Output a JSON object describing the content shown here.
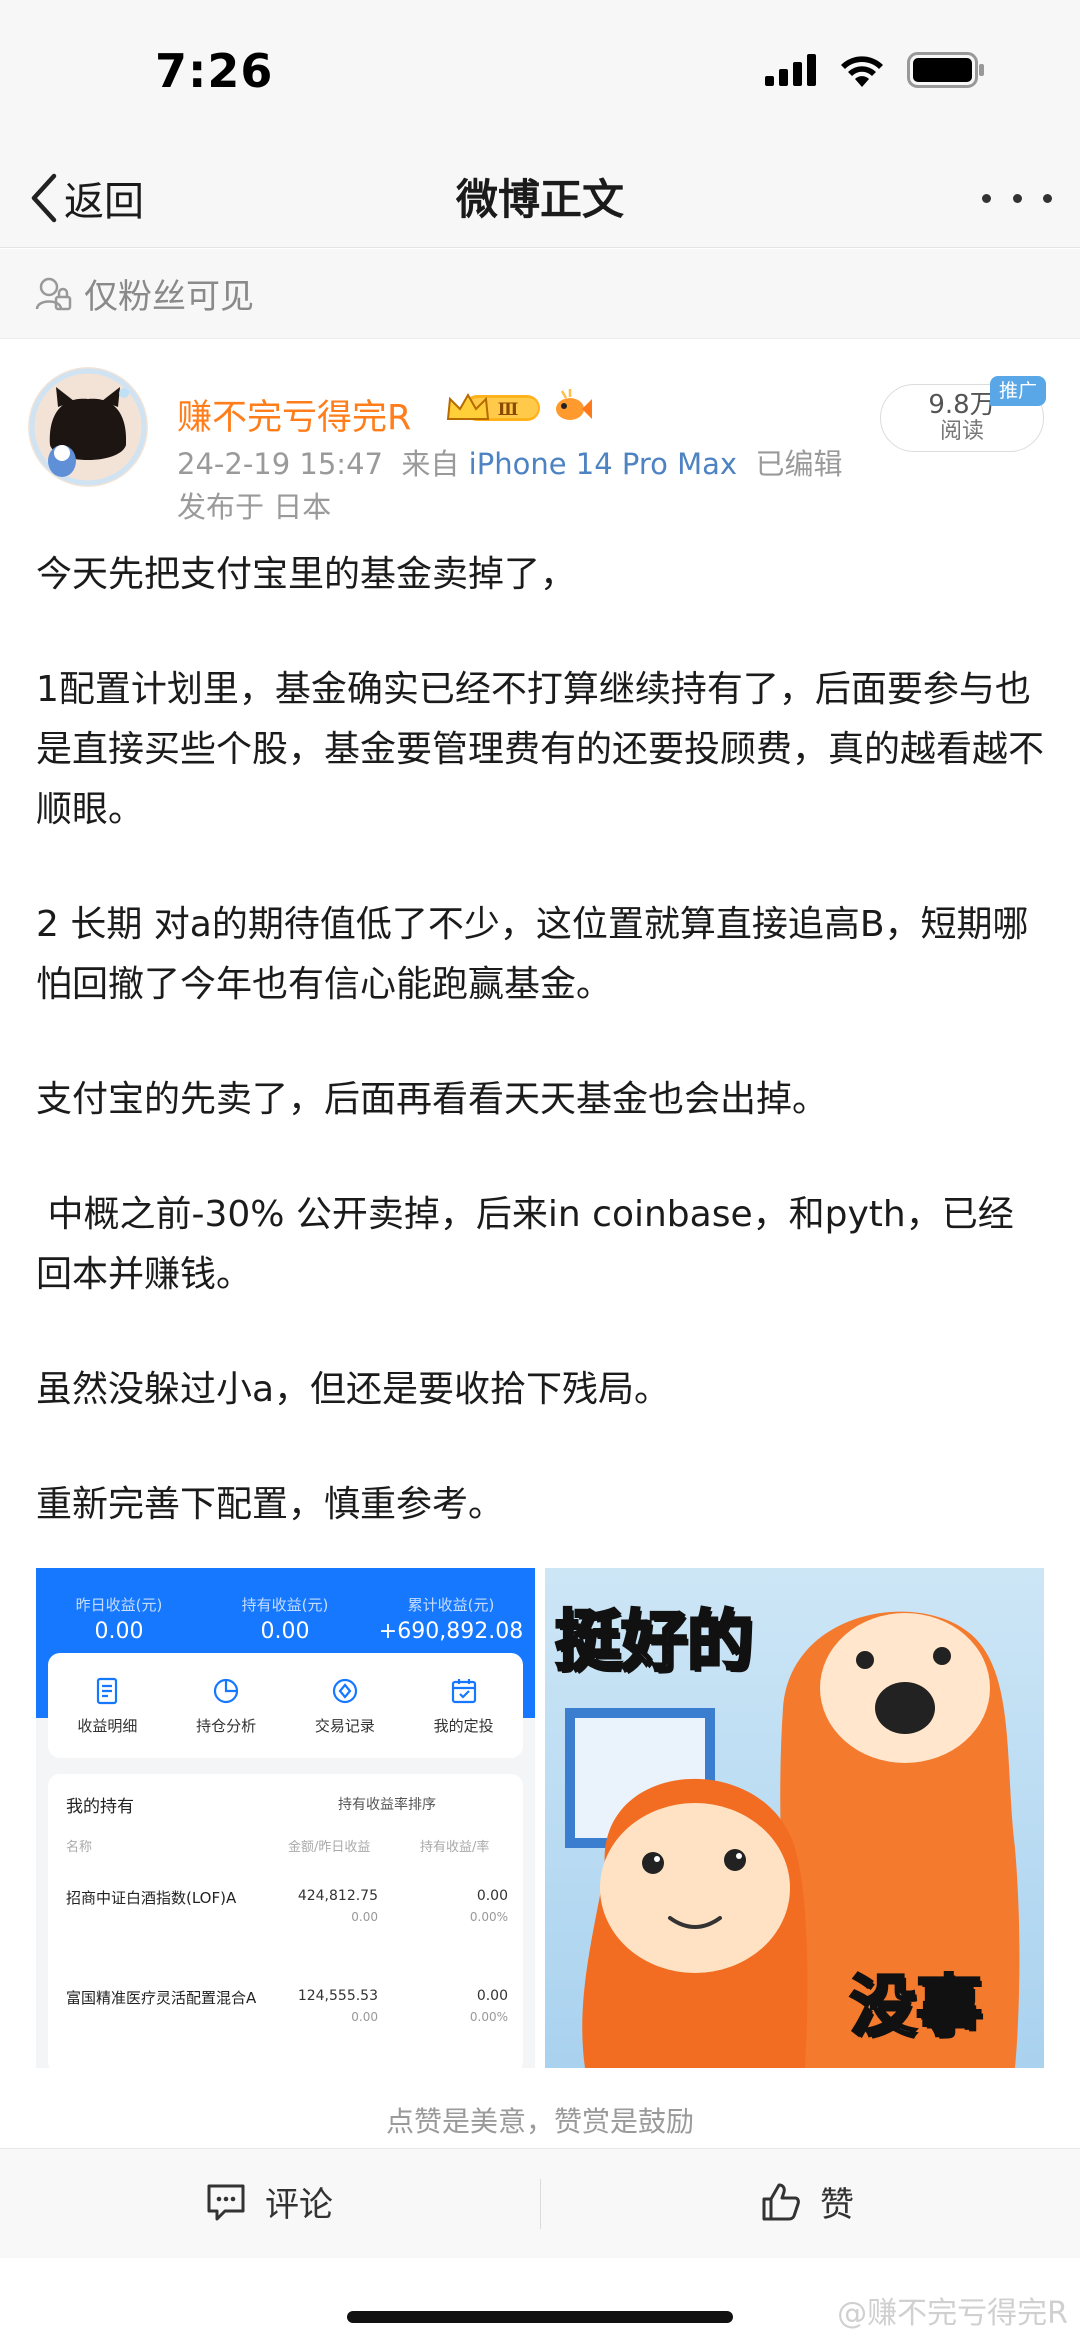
{
  "status_bar": {
    "time": "7:26"
  },
  "nav": {
    "back_label": "返回",
    "title": "微博正文"
  },
  "visibility": {
    "label": "仅粉丝可见"
  },
  "post": {
    "username": "赚不完亏得完R",
    "level_badge": "Ⅲ",
    "meta_time": "24-2-19 15:47",
    "meta_from": "来自",
    "meta_device": "iPhone 14 Pro Max",
    "meta_edited": "已编辑",
    "meta_location": "发布于 日本",
    "reads_count": "9.8万",
    "reads_label": "阅读",
    "promo_tag": "推广",
    "paragraphs": [
      "今天先把支付宝里的基金卖掉了，",
      "1配置计划里，基金确实已经不打算继续持有了，后面要参与也是直接买些个股，基金要管理费有的还要投顾费，真的越看越不顺眼。",
      "2 长期 对a的期待值低了不少，这位置就算直接追高B，短期哪怕回撤了今年也有信心能跑赢基金。",
      "支付宝的先卖了，后面再看看天天基金也会出掉。",
      " 中概之前-30% 公开卖掉，后来in coinbase，和pyth，已经回本并赚钱。",
      "虽然没躲过小a，但还是要收拾下残局。",
      "重新完善下配置，慎重参考。"
    ]
  },
  "fund_screenshot": {
    "stats": [
      {
        "label": "昨日收益(元)",
        "value": "0.00"
      },
      {
        "label": "持有收益(元)",
        "value": "0.00"
      },
      {
        "label": "累计收益(元)",
        "value": "+690,892.08"
      }
    ],
    "menu": [
      "收益明细",
      "持仓分析",
      "交易记录",
      "我的定投"
    ],
    "list_title": "我的持有",
    "sort_label": "持有收益率排序",
    "col_name": "名称",
    "col_amount": "金额/昨日收益",
    "col_profit": "持有收益/率",
    "rows": [
      {
        "name": "招商中证白酒指数(LOF)A",
        "amount": "424,812.75",
        "yesterday": "0.00",
        "profit": "0.00",
        "rate": "0.00%"
      },
      {
        "name": "富国精准医疗灵活配置混合A",
        "amount": "124,555.53",
        "yesterday": "0.00",
        "profit": "0.00",
        "rate": "0.00%"
      }
    ]
  },
  "meme": {
    "top_text": "挺好的",
    "bottom_text": "没事"
  },
  "reward_hint": "点赞是美意，赞赏是鼓励",
  "actions": {
    "comment_label": "评论",
    "like_label": "赞"
  },
  "watermark": "@赚不完亏得完R",
  "colors": {
    "username": "#ff7d1a",
    "device_link": "#4d83c2",
    "fund_blue": "#1677ff",
    "meme_orange": "#f47a2e"
  }
}
